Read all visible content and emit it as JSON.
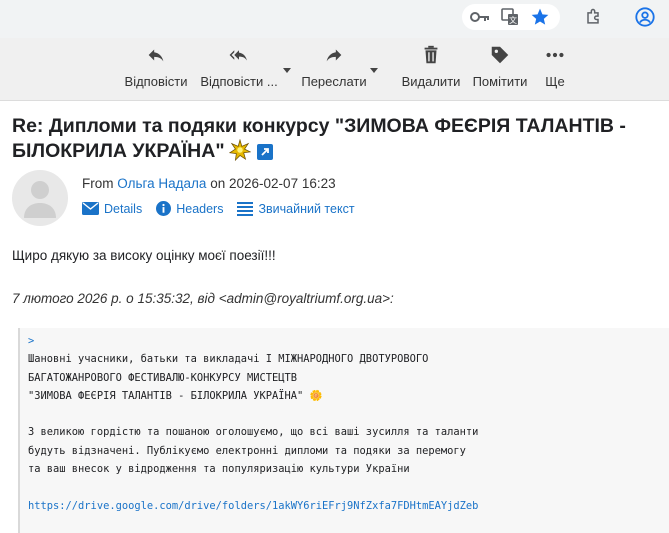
{
  "toolbar": {
    "reply": "Відповісти",
    "reply_all": "Відповісти ...",
    "forward": "Переслати",
    "delete": "Видалити",
    "mark": "Помітити",
    "more": "Ще"
  },
  "message": {
    "subject": "Re: Дипломи та подяки конкурсу \"ЗИМОВА ФЕЄРІЯ ТАЛАНТІВ - БІЛОКРИЛА УКРАЇНА\"",
    "from_prefix": "From",
    "sender": "Ольга Надала",
    "on": "on",
    "date": "2026-02-07 16:23",
    "details": "Details",
    "headers": "Headers",
    "plain_text": "Звичайний текст",
    "body": "Щиро дякую за високу оцінку моєї поезії!!!",
    "quote_header": "7 лютого 2026 р. о 15:35:32, від <admin@royaltriumf.org.ua>:"
  },
  "quote": {
    "gt": ">",
    "line1": "Шановні учасники, батьки та викладачі І МІЖНАРОДНОГО ДВОТУРОВОГО",
    "line2": "БАГАТОЖАНРОВОГО ФЕСТИВАЛЮ-КОНКУРСУ МИСТЕЦТВ",
    "line3": "\"ЗИМОВА ФЕЄРІЯ ТАЛАНТІВ - БІЛОКРИЛА УКРАЇНА\" 🌼",
    "line4": "З великою гордістю та пошаною оголошуємо, що всі ваші зусилля та таланти",
    "line5": "будуть відзначені. Публікуємо електронні дипломи та подяки за перемогу",
    "line6": "та ваш внесок у відродження та популяризацію культури України",
    "link": "https://drive.google.com/drive/folders/1akWY6riEFrj9NfZxfa7FDHtmEAYjdZeb"
  },
  "colors": {
    "link": "#1a73c8",
    "toolbar_bg": "#f0f0f0"
  }
}
